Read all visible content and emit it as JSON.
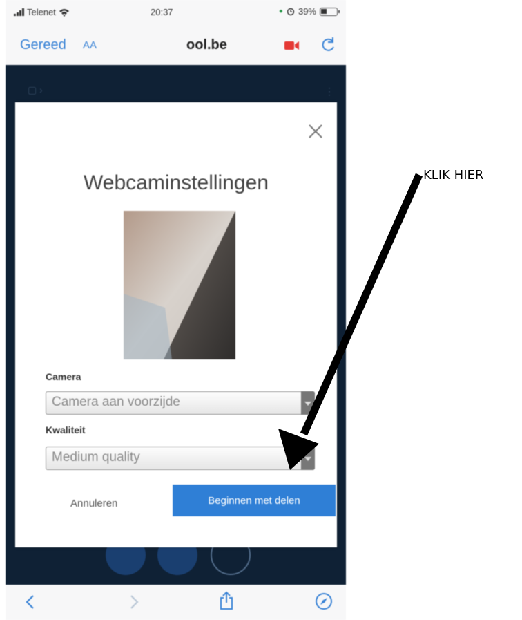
{
  "status_bar": {
    "carrier": "Telenet",
    "time": "20:37",
    "battery": "39%"
  },
  "browser": {
    "done_label": "Gereed",
    "text_size_label": "AA",
    "url": "ool.be"
  },
  "modal": {
    "title": "Webcaminstellingen",
    "camera_label": "Camera",
    "camera_value": "Camera aan voorzijde",
    "quality_label": "Kwaliteit",
    "quality_value": "Medium quality",
    "cancel_label": "Annuleren",
    "start_label": "Beginnen met delen"
  },
  "annotation": {
    "text": "KLIK HIER"
  },
  "colors": {
    "accent": "#2f7fd6",
    "link": "#3b84d6",
    "background_page": "#0f2135",
    "recording": "#e53935"
  },
  "icons": [
    "wifi-icon",
    "alarm-icon",
    "battery-icon",
    "camera-recording-icon",
    "reload-icon",
    "close-icon",
    "back-icon",
    "forward-icon",
    "share-icon",
    "compass-icon"
  ]
}
